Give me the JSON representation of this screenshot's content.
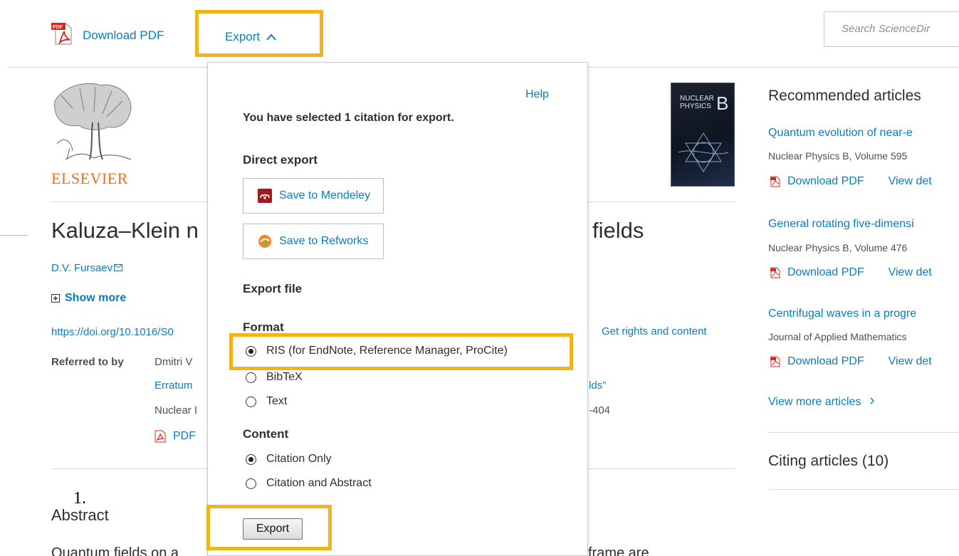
{
  "toolbar": {
    "download_pdf": "Download PDF",
    "export": "Export",
    "search_placeholder": "Search ScienceDir"
  },
  "logo": {
    "publisher": "ELSEVIER"
  },
  "journal_cover": {
    "title_line1": "NUCLEAR",
    "title_line2": "PHYSICS",
    "title_letter": "B"
  },
  "article": {
    "title_left": "Kaluza–Klein n",
    "title_right": "fields",
    "author": "D.V. Fursaev",
    "show_more": "Show more",
    "doi": "https://doi.org/10.1016/S0",
    "rights": "Get rights and content",
    "referred_label": "Referred to by",
    "referred_author": "Dmitri V",
    "erratum": "Erratum",
    "erratum_tail": "lds\"",
    "journal_fragment": "Nuclear I",
    "pages_fragment": "-404",
    "pdf": "PDF",
    "overlay_number": "1.",
    "abstract_heading": "Abstract",
    "abstract_left": "Quantum fields on a",
    "abstract_right": "frame are"
  },
  "recommended": {
    "heading": "Recommended articles",
    "items": [
      {
        "title": "Quantum evolution of near-e",
        "meta": "Nuclear Physics B, Volume 595",
        "download": "Download PDF",
        "view": "View det"
      },
      {
        "title": "General rotating five-dimensi",
        "meta": "Nuclear Physics B, Volume 476",
        "download": "Download PDF",
        "view": "View det"
      },
      {
        "title": "Centrifugal waves in a progre",
        "meta": "Journal of Applied Mathematics",
        "download": "Download PDF",
        "view": "View det"
      }
    ],
    "view_more": "View more articles",
    "citing": "Citing articles (10)"
  },
  "export_panel": {
    "help": "Help",
    "selected_text": "You have selected 1 citation for export.",
    "direct_export": "Direct export",
    "mendeley": "Save to Mendeley",
    "refworks": "Save to Refworks",
    "export_file": "Export file",
    "format_label": "Format",
    "formats": [
      {
        "label": "RIS (for EndNote, Reference Manager, ProCite)",
        "selected": true
      },
      {
        "label": "BibTeX",
        "selected": false
      },
      {
        "label": "Text",
        "selected": false
      }
    ],
    "content_label": "Content",
    "contents": [
      {
        "label": "Citation Only",
        "selected": true
      },
      {
        "label": "Citation and Abstract",
        "selected": false
      }
    ],
    "export_button": "Export"
  },
  "colors": {
    "link": "#0c7dbb",
    "highlight": "#f3b41b",
    "elsevier_orange": "#e9711c"
  }
}
